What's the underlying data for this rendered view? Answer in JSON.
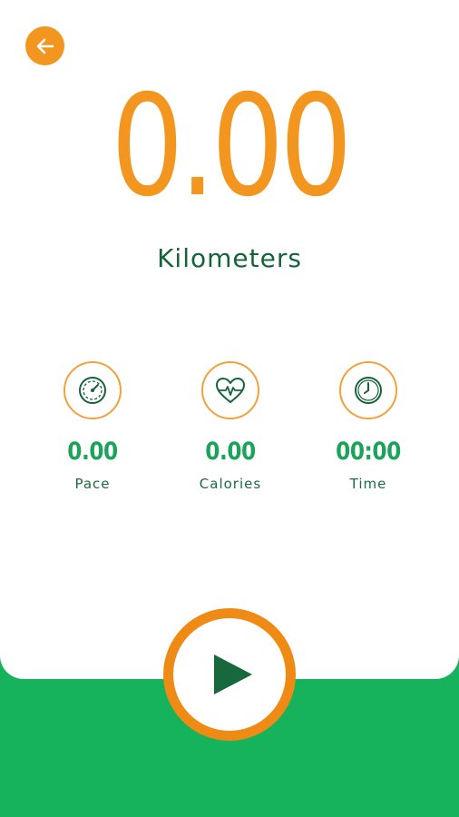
{
  "back": {
    "icon": "arrow-left-icon"
  },
  "distance": {
    "value": "0.00",
    "unit": "Kilometers"
  },
  "stats": {
    "pace": {
      "icon": "speedometer-icon",
      "value": "0.00",
      "label": "Pace"
    },
    "calories": {
      "icon": "heart-pulse-icon",
      "value": "0.00",
      "label": "Calories"
    },
    "time": {
      "icon": "clock-icon",
      "value": "00:00",
      "label": "Time"
    }
  },
  "play": {
    "icon": "play-icon"
  },
  "colors": {
    "accent_orange": "#f3961f",
    "brand_green": "#17b35c",
    "dark_green": "#15633a",
    "value_green": "#1ca35a",
    "card": "#ffffff"
  }
}
